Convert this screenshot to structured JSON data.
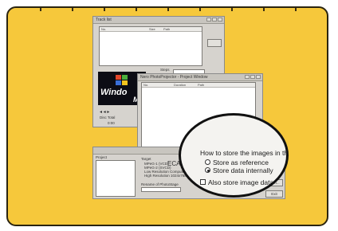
{
  "window_back": {
    "title": "Track list",
    "columns": [
      "No.",
      "Size",
      "Path"
    ],
    "steps_label": "Steps",
    "footer_left": "Disc Total",
    "footer_value": "0:00",
    "logo_text_top": "Windo",
    "logo_text_bottom": "Med"
  },
  "window_mid": {
    "title": "Nero PhotoProjector - Project Window",
    "columns": [
      "No.",
      "Duration",
      "Path"
    ]
  },
  "window_front": {
    "project_label": "Project",
    "target_label": "Target",
    "options": [
      "MPeG-1 (VCD)",
      "MPeG-2 (SVCD)",
      "Low Resolution Computer",
      "High Resolution 1024x768"
    ],
    "cam_label": "ECAM",
    "rename_label": "Rename of PhotoStage",
    "buttons": [
      "Add files",
      "Add Folder",
      "Burn...",
      "Exit"
    ]
  },
  "magnifier": {
    "heading": "How to store the images in the pro",
    "option_reference": "Store as reference",
    "option_internal": "Store data internally",
    "checkbox_label": "Also store image data into P"
  }
}
